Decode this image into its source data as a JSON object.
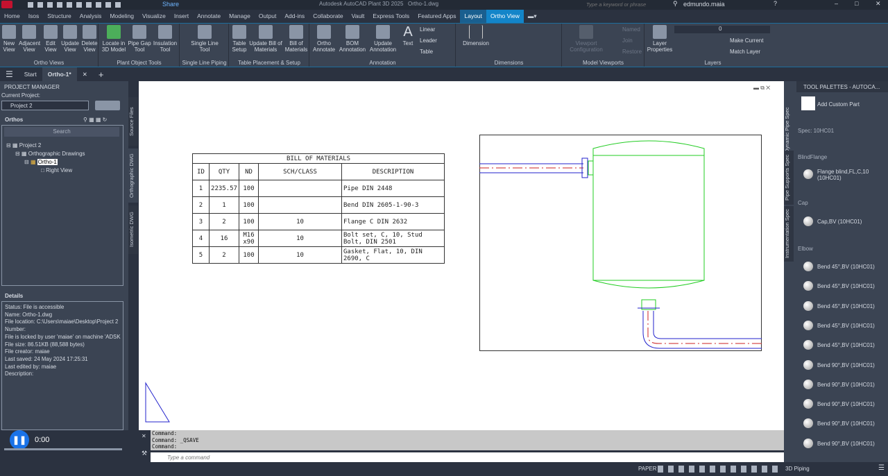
{
  "title_bar": {
    "app_title": "Autodesk AutoCAD Plant 3D 2025",
    "file": "Ortho-1.dwg",
    "share": "Share",
    "search_placeholder": "Type a keyword or phrase",
    "user": "edmundo.maia"
  },
  "ribbon_tabs": [
    "Home",
    "Isos",
    "Structure",
    "Analysis",
    "Modeling",
    "Visualize",
    "Insert",
    "Annotate",
    "Manage",
    "Output",
    "Add-ins",
    "Collaborate",
    "Vault",
    "Express Tools",
    "Featured Apps",
    "Layout",
    "Ortho View"
  ],
  "ribbon": {
    "ortho_views": {
      "title": "Ortho Views",
      "buttons": [
        "New View",
        "Adjacent View",
        "Edit View",
        "Update View",
        "Delete View"
      ]
    },
    "plant_object_tools": {
      "title": "Plant Object Tools",
      "buttons": [
        "Locate in 3D Model",
        "Pipe Gap Tool",
        "Insulation Tool"
      ]
    },
    "single_line_piping": {
      "title": "Single Line Piping",
      "buttons": [
        "Single Line Tool"
      ]
    },
    "table_placement": {
      "title": "Table Placement & Setup",
      "buttons": [
        "Table Setup",
        "Update Bill of Materials",
        "Bill of Materials"
      ]
    },
    "annotation": {
      "title": "Annotation",
      "buttons": [
        "Ortho Annotate",
        "BOM Annotation",
        "Update Annotation",
        "Text"
      ],
      "small": [
        "Linear",
        "Leader",
        "Table"
      ]
    },
    "dimensions": {
      "title": "Dimensions",
      "buttons": [
        "Dimension"
      ]
    },
    "model_viewports": {
      "title": "Model Viewports",
      "buttons": [
        "Viewport Configuration"
      ],
      "small": [
        "Named",
        "Join",
        "Restore"
      ]
    },
    "layers": {
      "title": "Layers",
      "buttons": [
        "Layer Properties"
      ],
      "layer_value": "0",
      "small": [
        "Make Current",
        "Match Layer"
      ]
    }
  },
  "doc_tabs": {
    "start": "Start",
    "active": "Ortho-1*"
  },
  "project_manager": {
    "title": "PROJECT MANAGER",
    "current_project_label": "Current Project:",
    "current_project": "Project 2",
    "orthos_label": "Orthos",
    "search_placeholder": "Search",
    "tree": [
      "Project 2",
      "Orthographic Drawings",
      "Ortho-1",
      "Right View"
    ],
    "side_tabs": [
      "Source Files",
      "Orthographic DWG",
      "Isometric DWG"
    ],
    "details_title": "Details",
    "details": [
      "Status: File is accessible",
      "Name: Ortho-1.dwg",
      "File location: C:\\Users\\maiae\\Desktop\\Project 2",
      "Number:",
      "File is locked by user 'maiae' on machine 'ADSK",
      "File size: 86.51KB (88,588 bytes)",
      "File creator: maiae",
      "Last saved: 24 May 2024 17:25:31",
      "Last edited by: maiae",
      "Description:"
    ],
    "video_time": "0:00"
  },
  "bom": {
    "title": "BILL OF MATERIALS",
    "headers": [
      "ID",
      "QTY",
      "ND",
      "SCH/CLASS",
      "DESCRIPTION"
    ],
    "rows": [
      [
        "1",
        "2235.57",
        "100",
        "",
        "Pipe DIN 2448"
      ],
      [
        "2",
        "1",
        "100",
        "",
        "Bend DIN 2605-1-90-3"
      ],
      [
        "3",
        "2",
        "100",
        "10",
        "Flange C DIN 2632"
      ],
      [
        "4",
        "16",
        "M16 x90",
        "10",
        "Bolt set, C, 10, Stud Bolt, DIN 2501"
      ],
      [
        "5",
        "2",
        "100",
        "10",
        "Gasket, Flat, 10, DIN 2690, C"
      ]
    ]
  },
  "command": {
    "history": [
      "Command:",
      "Command: _QSAVE",
      "Command:"
    ],
    "placeholder": "Type a command"
  },
  "status_bar": {
    "space": "PAPER",
    "workspace": "3D Piping"
  },
  "tool_palettes": {
    "title": "TOOL PALETTES - AUTOCA...",
    "add_custom": "Add Custom Part",
    "spec": "Spec: 10HC01",
    "side_tabs": [
      "Dynamic Pipe Spec",
      "Pipe Supports Spec",
      "Instrumentation Spec"
    ],
    "groups": [
      {
        "name": "BlindFlange",
        "items": [
          "Flange blind,FL,C,10 (10HC01)"
        ]
      },
      {
        "name": "Cap",
        "items": [
          "Cap,BV (10HC01)"
        ]
      },
      {
        "name": "Elbow",
        "items": [
          "Bend 45°,BV (10HC01)",
          "Bend 45°,BV (10HC01)",
          "Bend 45°,BV (10HC01)",
          "Bend 45°,BV (10HC01)",
          "Bend 45°,BV (10HC01)",
          "Bend 90°,BV (10HC01)",
          "Bend 90°,BV (10HC01)",
          "Bend 90°,BV (10HC01)",
          "Bend 90°,BV (10HC01)",
          "Bend 90°,BV (10HC01)"
        ]
      }
    ]
  },
  "colors": {
    "accent": "#1385c9",
    "vessel": "#22cc22",
    "pipe_blue": "#2222cc",
    "pipe_red": "#cc2222"
  }
}
